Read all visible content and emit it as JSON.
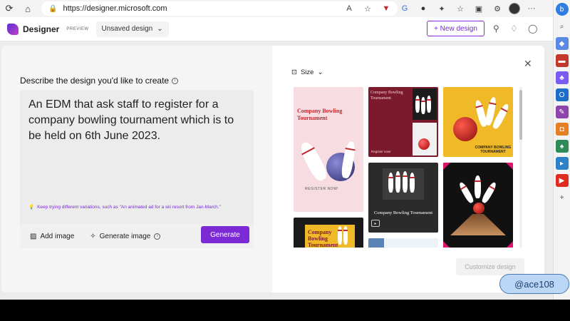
{
  "browser": {
    "url": "https://designer.microsoft.com"
  },
  "header": {
    "brand": "Designer",
    "preview_badge": "PREVIEW",
    "unsaved": "Unsaved design",
    "new_design": "+ New design"
  },
  "left": {
    "heading": "Describe the design you'd like to create",
    "prompt": "An EDM that ask staff to register for a company bowling tournament which is to be held on 6th June 2023.",
    "tip": "Keep trying different variations, such as \"An animated ad for a ski resort from Jan-March.\"",
    "add_image": "Add image",
    "generate_image": "Generate image",
    "generate": "Generate"
  },
  "right": {
    "size": "Size",
    "customize": "Customize design",
    "cards": {
      "c1_title": "Company Bowling Tournament",
      "c1_footer": "REGISTER NOW!",
      "c2_title": "Company Bowling Tournament",
      "c2_footer": "Register now!",
      "c3_title": "COMPANY BOWLING TOURNAMENT",
      "c4_title": "Company Bowling Tournament",
      "c5_title": "Company Bowling Tournament"
    }
  },
  "watermark": "@ace108",
  "colors": {
    "accent": "#7b2ad6",
    "pink_card": "#f7dde2",
    "maroon_card": "#7b1a2c",
    "yellow_card": "#f0b928"
  }
}
